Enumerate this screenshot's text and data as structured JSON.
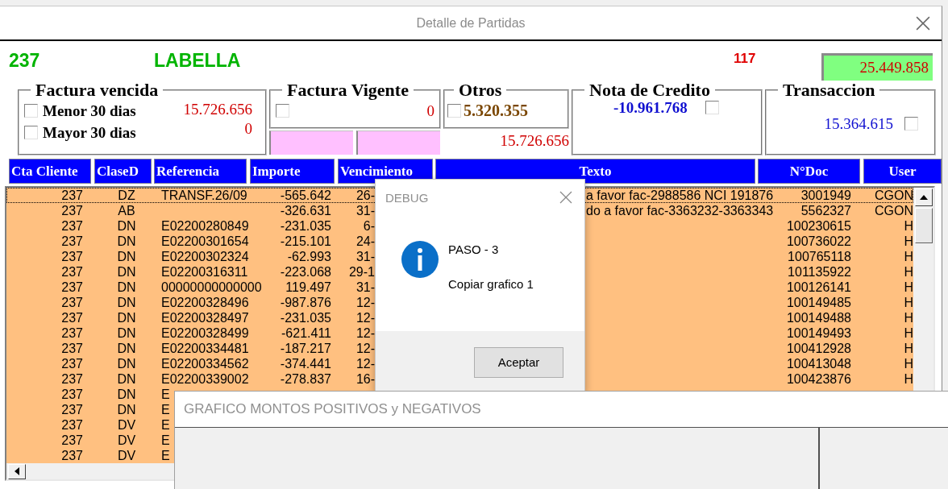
{
  "window": {
    "title": "Detalle de Partidas"
  },
  "header": {
    "account": "237",
    "name": "LABELLA",
    "count": "117",
    "total": "25.449.858"
  },
  "groups": [
    {
      "kind": "split",
      "title": "Factura vencida",
      "options": [
        {
          "label": "Menor 30 dias",
          "checked": false,
          "amount": "15.726.656"
        },
        {
          "label": "Mayor 30 dias",
          "checked": false,
          "amount": "0"
        }
      ]
    },
    {
      "kind": "fields",
      "title": "Factura Vigente",
      "checked": false,
      "amount": "0"
    },
    {
      "kind": "subtotal",
      "title": "Otros",
      "checked": false,
      "amount": "5.320.355",
      "subtotal": "15.726.656"
    },
    {
      "kind": "credit",
      "title": "Nota de Credito",
      "checked": false,
      "amount": "-10.961.768"
    },
    {
      "kind": "low",
      "title": "Transaccion",
      "checked": false,
      "amount": "15.364.615"
    }
  ],
  "table": {
    "columns": [
      "Cta Cliente",
      "ClaseD",
      "Referencia",
      "Importe",
      "Vencimiento",
      "Texto",
      "N°Doc",
      "User"
    ],
    "rows": [
      {
        "selected": true,
        "cta": "237",
        "clase": "DZ",
        "ref": "TRANSF.26/09",
        "importe": "-565.642",
        "venc": "26-",
        "texto": "a favor fac-2988586 NCI 191876",
        "ndoc": "3001949",
        "user": "CGON"
      },
      {
        "selected": false,
        "cta": "237",
        "clase": "AB",
        "importe": "-326.631",
        "venc": "31-",
        "texto": "do a favor fac-3363232-3363343",
        "ndoc": "5562327",
        "user": "CGON"
      },
      {
        "selected": false,
        "cta": "237",
        "clase": "DN",
        "ref": "E02200280849",
        "importe": "-231.035",
        "venc": "6-",
        "ndoc": "100230615",
        "user": "H"
      },
      {
        "selected": false,
        "cta": "237",
        "clase": "DN",
        "ref": "E02200301654",
        "importe": "-215.101",
        "venc": "24-",
        "ndoc": "100736022",
        "user": "H"
      },
      {
        "selected": false,
        "cta": "237",
        "clase": "DN",
        "ref": "E02200302324",
        "importe": "-62.993",
        "venc": "31-",
        "ndoc": "100765118",
        "user": "H"
      },
      {
        "selected": false,
        "cta": "237",
        "clase": "DN",
        "ref": "E02200316311",
        "importe": "-223.068",
        "venc": "29-1",
        "ndoc": "101135922",
        "user": "H"
      },
      {
        "selected": false,
        "cta": "237",
        "clase": "DN",
        "ref": "00000000000000",
        "importe": "119.497",
        "venc": "31-",
        "ndoc": "100126141",
        "user": "H"
      },
      {
        "selected": false,
        "cta": "237",
        "clase": "DN",
        "ref": "E02200328496",
        "importe": "-987.876",
        "venc": "12-",
        "ndoc": "100149485",
        "user": "H"
      },
      {
        "selected": false,
        "cta": "237",
        "clase": "DN",
        "ref": "E02200328497",
        "importe": "-231.035",
        "venc": "12-",
        "ndoc": "100149488",
        "user": "H"
      },
      {
        "selected": false,
        "cta": "237",
        "clase": "DN",
        "ref": "E02200328499",
        "importe": "-621.411",
        "venc": "12-",
        "ndoc": "100149493",
        "user": "H"
      },
      {
        "selected": false,
        "cta": "237",
        "clase": "DN",
        "ref": "E02200334481",
        "importe": "-187.217",
        "venc": "12-",
        "ndoc": "100412928",
        "user": "H"
      },
      {
        "selected": false,
        "cta": "237",
        "clase": "DN",
        "ref": "E02200334562",
        "importe": "-374.441",
        "venc": "12-",
        "ndoc": "100413048",
        "user": "H"
      },
      {
        "selected": false,
        "cta": "237",
        "clase": "DN",
        "ref": "E02200339002",
        "importe": "-278.837",
        "venc": "16-",
        "ndoc": "100423876",
        "user": "H"
      },
      {
        "selected": false,
        "cta": "237",
        "clase": "DN",
        "ref": "E"
      },
      {
        "selected": false,
        "cta": "237",
        "clase": "DN",
        "ref": "E"
      },
      {
        "selected": false,
        "cta": "237",
        "clase": "DV",
        "ref": "E"
      },
      {
        "selected": false,
        "cta": "237",
        "clase": "DV",
        "ref": "E"
      },
      {
        "selected": false,
        "cta": "237",
        "clase": "DV",
        "ref": "E"
      }
    ]
  },
  "debug_dialog": {
    "title": "DEBUG",
    "lines": [
      "PASO - 3",
      "Copiar grafico 1"
    ],
    "button": "Aceptar"
  },
  "chart_window": {
    "title": "GRAFICO MONTOS POSITIVOS y NEGATIVOS"
  }
}
